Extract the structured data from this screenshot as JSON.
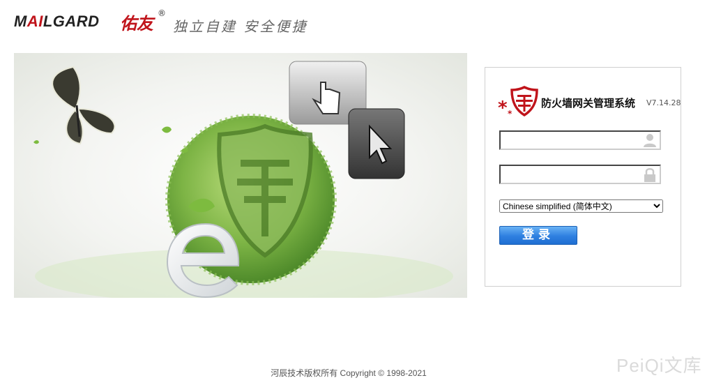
{
  "header": {
    "logo_prefix": "MAILGARD",
    "logo_cn": "佑友",
    "logo_reg": "®",
    "slogan": "独立自建  安全便捷"
  },
  "login": {
    "title": "防火墙网关管理系统",
    "version": "V7.14.28",
    "username_placeholder": "",
    "password_placeholder": "",
    "language_selected": "Chinese simplified (简体中文)",
    "login_label": "登录"
  },
  "footer": {
    "copyright": "河辰技术版权所有 Copyright © 1998-2021"
  },
  "watermark": "PeiQi文库",
  "colors": {
    "brand_red": "#c0141b",
    "button_blue": "#2e7fe0",
    "leaf_green": "#6fa53a"
  },
  "icons": {
    "user": "user-icon",
    "lock": "lock-icon",
    "shield": "shield-icon"
  }
}
